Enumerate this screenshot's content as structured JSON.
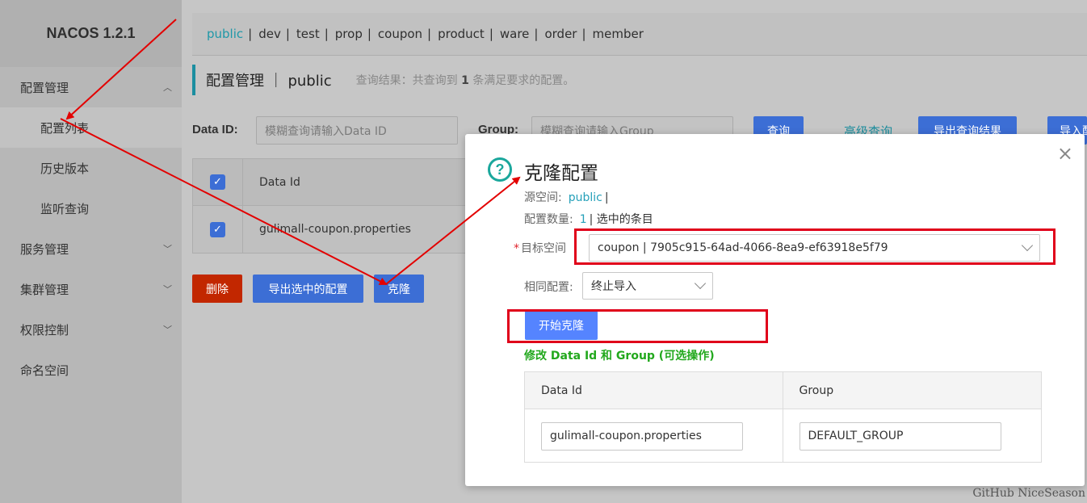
{
  "sidebar": {
    "brand": "NACOS 1.2.1",
    "items": [
      {
        "label": "配置管理",
        "expanded": true
      },
      {
        "label": "配置列表"
      },
      {
        "label": "历史版本"
      },
      {
        "label": "监听查询"
      },
      {
        "label": "服务管理"
      },
      {
        "label": "集群管理"
      },
      {
        "label": "权限控制"
      },
      {
        "label": "命名空间"
      }
    ]
  },
  "namespaces": [
    "public",
    "dev",
    "test",
    "prop",
    "coupon",
    "product",
    "ware",
    "order",
    "member"
  ],
  "ns_sep": "|",
  "page": {
    "title": "配置管理 ｜ public",
    "query_prefix": "查询结果：共查询到",
    "query_count": "1",
    "query_suffix": "条满足要求的配置。"
  },
  "filters": {
    "data_id_label": "Data ID:",
    "data_id_placeholder": "模糊查询请输入Data ID",
    "group_label": "Group:",
    "group_placeholder": "模糊查询请输入Group",
    "query_btn": "查询",
    "advanced_query": "高级查询",
    "export_results": "导出查询结果",
    "import": "导入配"
  },
  "table": {
    "header": "Data Id",
    "rows": [
      "gulimall-coupon.properties"
    ],
    "checkmark": "✓"
  },
  "actions": {
    "delete": "删除",
    "export_selected": "导出选中的配置",
    "clone": "克隆"
  },
  "dialog": {
    "icon": "?",
    "title": "克隆配置",
    "source_label": "源空间:",
    "source_value": "public",
    "source_suffix": "|",
    "count_label": "配置数量:",
    "count_value": "1",
    "count_suffix": "| 选中的条目",
    "required_mark": "*",
    "target_label": "目标空间",
    "target_value": "coupon | 7905c915-64ad-4066-8ea9-ef63918e5f79",
    "same_label": "相同配置:",
    "same_value": "终止导入",
    "start_btn": "开始克隆",
    "hint": "修改 Data Id 和 Group (可选操作)",
    "col_data_id": "Data Id",
    "col_group": "Group",
    "row_data_id": "gulimall-coupon.properties",
    "row_group": "DEFAULT_GROUP",
    "close": "×"
  },
  "watermark": "GitHub NiceSeason",
  "colors": {
    "accent": "#1f98a8",
    "primary": "#3c6ed5",
    "danger": "#c22700",
    "highlight": "#e0001a",
    "arrow": "#e30000",
    "hint": "#22a81d"
  }
}
